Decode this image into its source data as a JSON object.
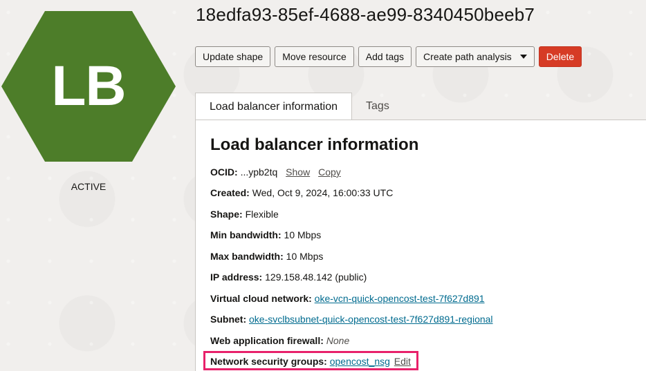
{
  "badge": {
    "initials": "LB",
    "status": "ACTIVE",
    "color": "#4d7d29"
  },
  "title": "18edfa93-85ef-4688-ae99-8340450beeb7",
  "actions": {
    "update_shape": "Update shape",
    "move_resource": "Move resource",
    "add_tags": "Add tags",
    "create_path_analysis": "Create path analysis",
    "delete": "Delete"
  },
  "tabs": [
    {
      "label": "Load balancer information",
      "active": true
    },
    {
      "label": "Tags",
      "active": false
    }
  ],
  "panel": {
    "heading": "Load balancer information",
    "ocid": {
      "key": "OCID:",
      "value": "...ypb2tq",
      "show": "Show",
      "copy": "Copy"
    },
    "created": {
      "key": "Created:",
      "value": "Wed, Oct 9, 2024, 16:00:33 UTC"
    },
    "shape": {
      "key": "Shape:",
      "value": "Flexible"
    },
    "min_bandwidth": {
      "key": "Min bandwidth:",
      "value": "10 Mbps"
    },
    "max_bandwidth": {
      "key": "Max bandwidth:",
      "value": "10 Mbps"
    },
    "ip_address": {
      "key": "IP address:",
      "value": "129.158.48.142 (public)"
    },
    "vcn": {
      "key": "Virtual cloud network:",
      "value": "oke-vcn-quick-opencost-test-7f627d891"
    },
    "subnet": {
      "key": "Subnet:",
      "value": "oke-svclbsubnet-quick-opencost-test-7f627d891-regional"
    },
    "waf": {
      "key": "Web application firewall:",
      "value": "None"
    },
    "nsg": {
      "key": "Network security groups:",
      "value": "opencost_nsg",
      "edit": "Edit"
    }
  },
  "colors": {
    "accent_link": "#006b8f",
    "danger": "#d63b25",
    "highlight": "#e8216a"
  }
}
